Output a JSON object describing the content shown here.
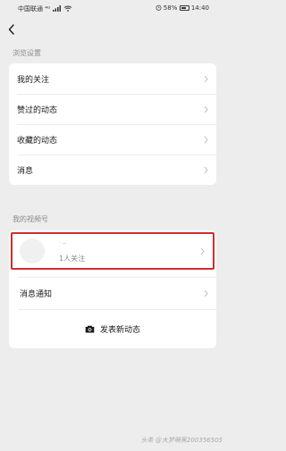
{
  "status_bar": {
    "carrier": "中国联通",
    "network": "⁴ᴳ",
    "battery": "58%",
    "time": "14:40"
  },
  "browse_section": {
    "label": "浏览设置",
    "items": [
      {
        "label": "我的关注"
      },
      {
        "label": "赞过的动态"
      },
      {
        "label": "收藏的动态"
      },
      {
        "label": "消息"
      }
    ]
  },
  "channel_section": {
    "label": "我的视频号",
    "profile": {
      "name": "· ⌣",
      "followers": "1人关注"
    },
    "notify_label": "消息通知",
    "publish_label": "发表新动态"
  },
  "watermark": "头条 @大梦萌蕉200356505",
  "icons": [
    "back-icon",
    "chevron-right-icon",
    "camera-icon",
    "signal-icon",
    "wifi-icon",
    "alarm-icon",
    "battery-icon"
  ]
}
